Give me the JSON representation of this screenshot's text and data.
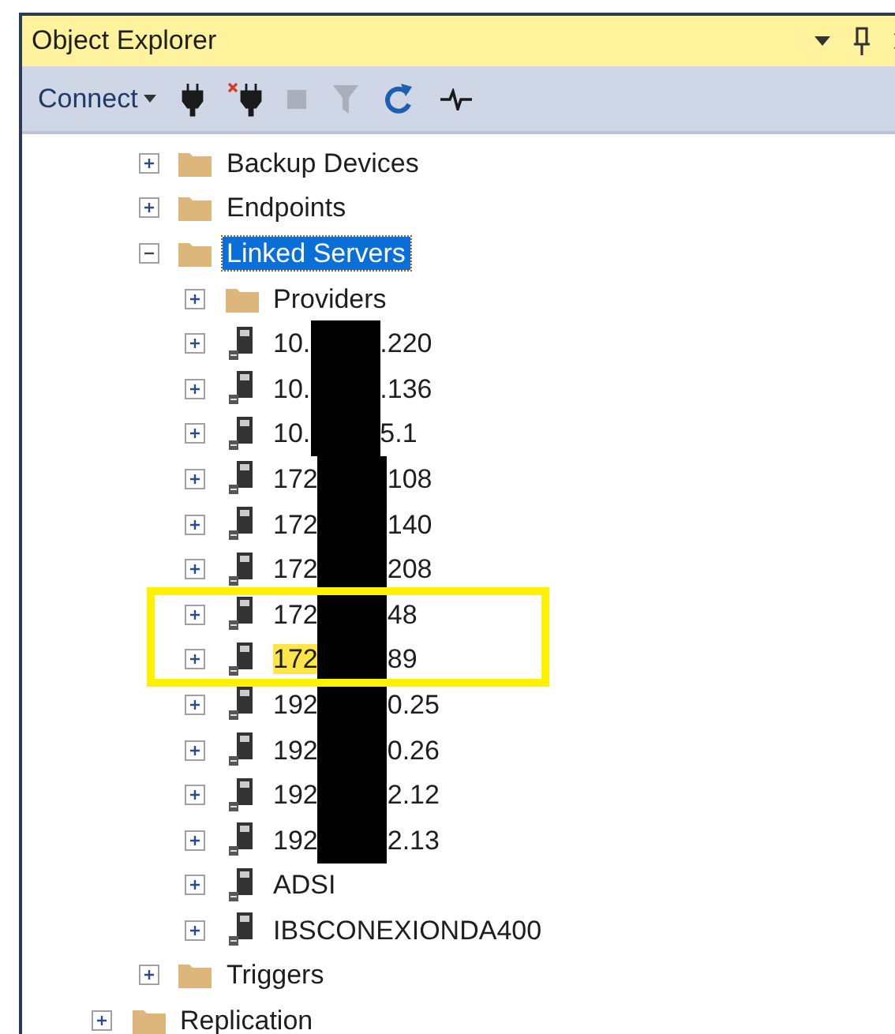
{
  "window": {
    "title": "Object Explorer",
    "controls": [
      {
        "kind": "dropdown"
      },
      {
        "kind": "pin"
      },
      {
        "kind": "close"
      }
    ]
  },
  "toolbar": {
    "tools": [
      {
        "kind": "connect",
        "label": "Connect",
        "disabled": false
      },
      {
        "kind": "plug",
        "disabled": false
      },
      {
        "kind": "unplug",
        "disabled": false
      },
      {
        "kind": "stop",
        "disabled": true
      },
      {
        "kind": "filter",
        "disabled": true
      },
      {
        "kind": "refresh",
        "disabled": false
      },
      {
        "kind": "activity",
        "disabled": false
      }
    ]
  },
  "tree": {
    "nodes": [
      {
        "kind": "offscreen",
        "children": [
          {
            "kind": "folder",
            "label": "Backup Devices",
            "expanded": false,
            "selected": false
          },
          {
            "kind": "folder",
            "label": "Endpoints",
            "expanded": false,
            "selected": false
          },
          {
            "kind": "folder",
            "label": "Linked Servers",
            "expanded": true,
            "selected": true,
            "children": [
              {
                "kind": "folder",
                "label": "Providers",
                "expanded": false,
                "selected": false
              },
              {
                "kind": "server",
                "label_start": "10.",
                "label_end": ".220",
                "redacted": true,
                "expanded": false,
                "selected": false
              },
              {
                "kind": "server",
                "label_start": "10.",
                "label_end": ".136",
                "redacted": true,
                "expanded": false,
                "selected": false
              },
              {
                "kind": "server",
                "label_start": "10.",
                "label_end": "5.1",
                "redacted": true,
                "expanded": false,
                "selected": false
              },
              {
                "kind": "server",
                "label_start": "172",
                "label_end": "108",
                "redacted": true,
                "expanded": false,
                "selected": false
              },
              {
                "kind": "server",
                "label_start": "172",
                "label_end": "140",
                "redacted": true,
                "expanded": false,
                "selected": false
              },
              {
                "kind": "server",
                "label_start": "172",
                "label_end": "208",
                "redacted": true,
                "expanded": false,
                "selected": false
              },
              {
                "kind": "server",
                "label_start": "172",
                "label_end": "48",
                "redacted": true,
                "expanded": false,
                "selected": false,
                "outlined": true
              },
              {
                "kind": "server",
                "label_start": "172",
                "label_end": "89",
                "redacted": true,
                "expanded": false,
                "selected": false,
                "outlined": true,
                "marked": true
              },
              {
                "kind": "server",
                "label_start": "192",
                "label_end": "0.25",
                "redacted": true,
                "expanded": false,
                "selected": false
              },
              {
                "kind": "server",
                "label_start": "192",
                "label_end": "0.26",
                "redacted": true,
                "expanded": false,
                "selected": false
              },
              {
                "kind": "server",
                "label_start": "192",
                "label_end": "2.12",
                "redacted": true,
                "expanded": false,
                "selected": false
              },
              {
                "kind": "server",
                "label_start": "192",
                "label_end": "2.13",
                "redacted": true,
                "expanded": false,
                "selected": false
              },
              {
                "kind": "server",
                "label": "ADSI",
                "expanded": false,
                "selected": false
              },
              {
                "kind": "server",
                "label": "IBSCONEXIONDA400",
                "expanded": false,
                "selected": false
              }
            ]
          },
          {
            "kind": "folder",
            "label": "Triggers",
            "expanded": false,
            "selected": false
          }
        ]
      },
      {
        "kind": "folder",
        "label": "Replication",
        "expanded": false,
        "selected": false
      }
    ]
  }
}
